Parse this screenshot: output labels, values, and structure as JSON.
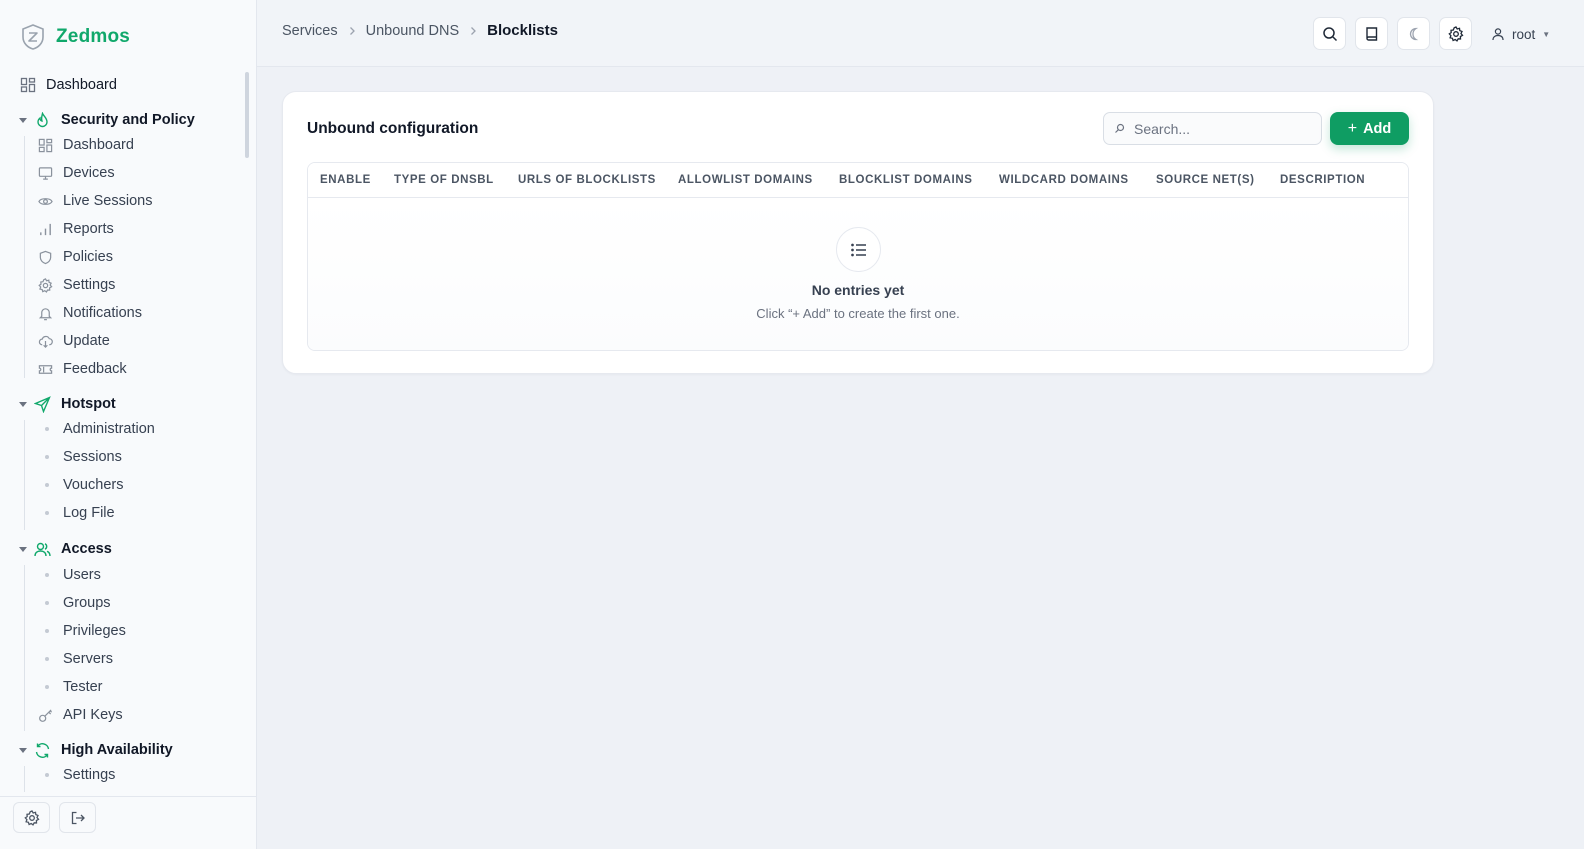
{
  "app": {
    "name": "Zedmos"
  },
  "breadcrumb": {
    "items": [
      "Services",
      "Unbound DNS"
    ],
    "current": "Blocklists"
  },
  "user": {
    "name": "root"
  },
  "sidebar": {
    "dashboard": "Dashboard",
    "sections": [
      {
        "title": "Security and Policy",
        "icon": "flame-icon",
        "items": [
          {
            "label": "Dashboard",
            "icon": "grid-icon"
          },
          {
            "label": "Devices",
            "icon": "monitor-icon"
          },
          {
            "label": "Live Sessions",
            "icon": "eye-icon"
          },
          {
            "label": "Reports",
            "icon": "bar-chart-icon"
          },
          {
            "label": "Policies",
            "icon": "shield-icon"
          },
          {
            "label": "Settings",
            "icon": "gear-icon"
          },
          {
            "label": "Notifications",
            "icon": "bell-icon"
          },
          {
            "label": "Update",
            "icon": "cloud-download-icon"
          },
          {
            "label": "Feedback",
            "icon": "ticket-icon"
          }
        ]
      },
      {
        "title": "Hotspot",
        "icon": "send-icon",
        "items": [
          {
            "label": "Administration",
            "icon": "dot"
          },
          {
            "label": "Sessions",
            "icon": "dot"
          },
          {
            "label": "Vouchers",
            "icon": "dot"
          },
          {
            "label": "Log File",
            "icon": "dot"
          }
        ]
      },
      {
        "title": "Access",
        "icon": "users-icon",
        "items": [
          {
            "label": "Users",
            "icon": "dot"
          },
          {
            "label": "Groups",
            "icon": "dot"
          },
          {
            "label": "Privileges",
            "icon": "dot"
          },
          {
            "label": "Servers",
            "icon": "dot"
          },
          {
            "label": "Tester",
            "icon": "dot"
          },
          {
            "label": "API Keys",
            "icon": "key-icon"
          }
        ]
      },
      {
        "title": "High Availability",
        "icon": "refresh-icon",
        "items": [
          {
            "label": "Settings",
            "icon": "dot"
          }
        ]
      }
    ]
  },
  "card": {
    "title": "Unbound configuration",
    "search_placeholder": "Search...",
    "add_label": "Add",
    "columns": [
      "ENABLE",
      "TYPE OF DNSBL",
      "URLS OF BLOCKLISTS",
      "ALLOWLIST DOMAINS",
      "BLOCKLIST DOMAINS",
      "WILDCARD DOMAINS",
      "SOURCE NET(S)",
      "DESCRIPTION"
    ],
    "empty_title": "No entries yet",
    "empty_subtitle": "Click “+ Add” to create the first one."
  },
  "colors": {
    "brand": "#10a86b",
    "accent": "#0f9d63"
  }
}
